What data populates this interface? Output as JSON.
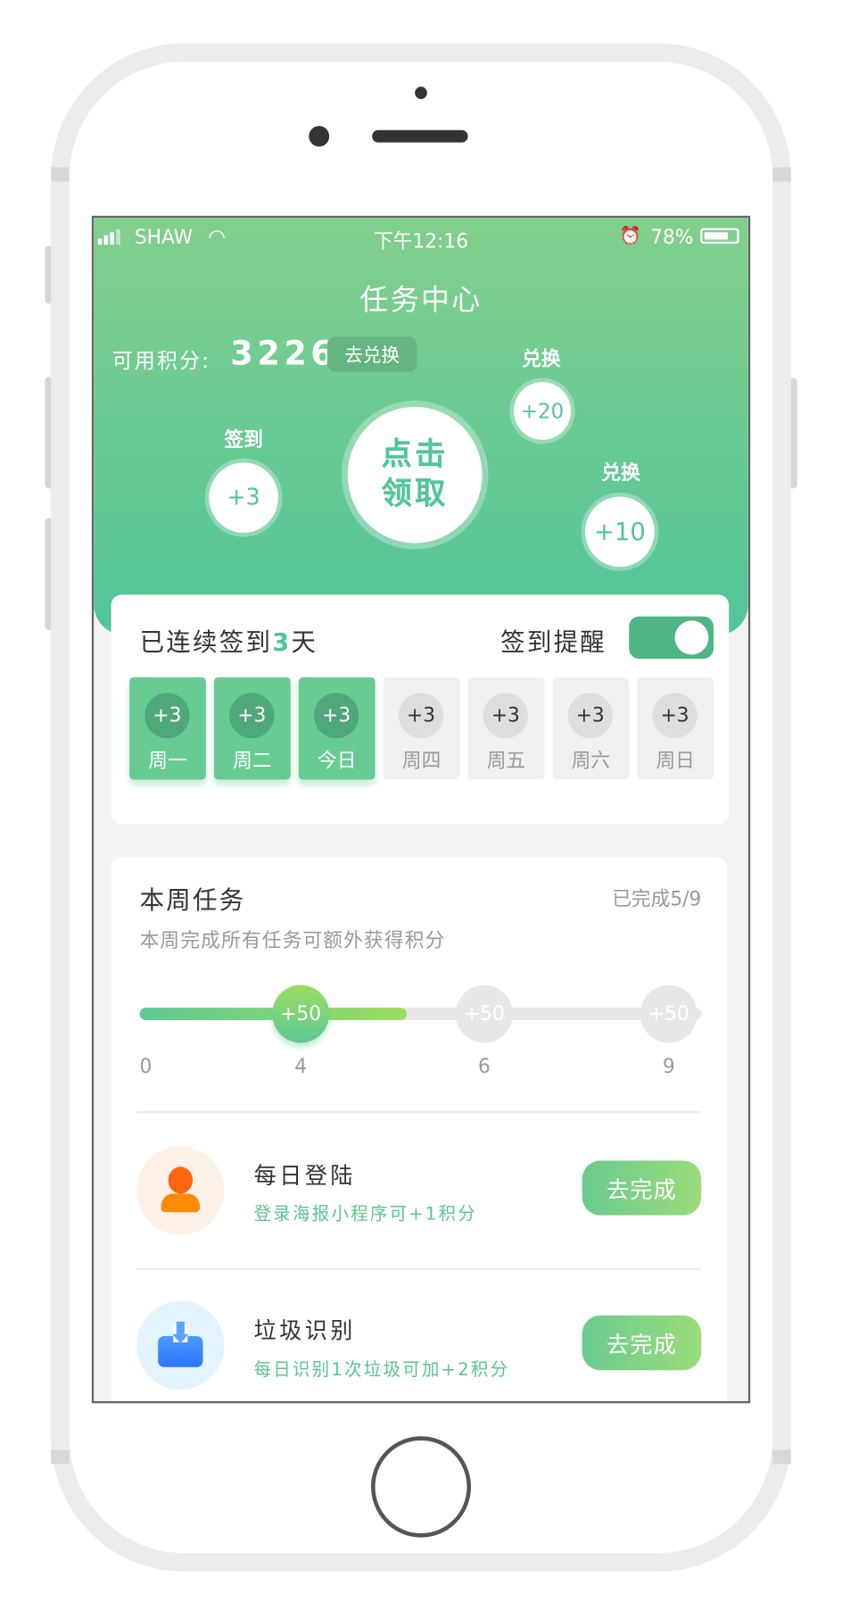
{
  "status_bar": {
    "carrier": "SHAW",
    "time": "下午12:16",
    "battery": "78%"
  },
  "header": {
    "title": "任务中心",
    "points_label": "可用积分:",
    "points_value": "3226",
    "redeem_button": "去兑换"
  },
  "bubbles": [
    {
      "label": "签到",
      "value": "+3"
    },
    {
      "label": "",
      "value": "点击领取",
      "line1": "点击",
      "line2": "领取"
    },
    {
      "label": "兑换",
      "value": "+20"
    },
    {
      "label": "兑换",
      "value": "+10"
    }
  ],
  "checkin": {
    "title_prefix": "已连续签到",
    "days": "3",
    "title_suffix": "天",
    "reminder_label": "签到提醒",
    "reminder_on": true,
    "days_list": [
      {
        "points": "+3",
        "label": "周一",
        "done": true
      },
      {
        "points": "+3",
        "label": "周二",
        "done": true
      },
      {
        "points": "+3",
        "label": "今日",
        "done": true
      },
      {
        "points": "+3",
        "label": "周四",
        "done": false
      },
      {
        "points": "+3",
        "label": "周五",
        "done": false
      },
      {
        "points": "+3",
        "label": "周六",
        "done": false
      },
      {
        "points": "+3",
        "label": "周日",
        "done": false
      }
    ]
  },
  "weekly": {
    "title": "本周任务",
    "progress_text": "已完成5/9",
    "subtitle": "本周完成所有任务可额外获得积分",
    "completed": 5,
    "total": 9,
    "milestones": [
      {
        "at": "4",
        "reward": "+50",
        "reached": true
      },
      {
        "at": "6",
        "reward": "+50",
        "reached": false
      },
      {
        "at": "9",
        "reward": "+50",
        "reached": false
      }
    ],
    "start_label": "0"
  },
  "tasks": [
    {
      "title": "每日登陆",
      "desc": "登录海报小程序可+1积分",
      "button": "去完成",
      "icon": "user-icon"
    },
    {
      "title": "垃圾识别",
      "desc": "每日识别1次垃圾可加+2积分",
      "button": "去完成",
      "icon": "inbox-download-icon"
    }
  ],
  "colors": {
    "accent": "#52c59a",
    "header_top": "#82cf8c",
    "task_text": "#5cc48d"
  }
}
